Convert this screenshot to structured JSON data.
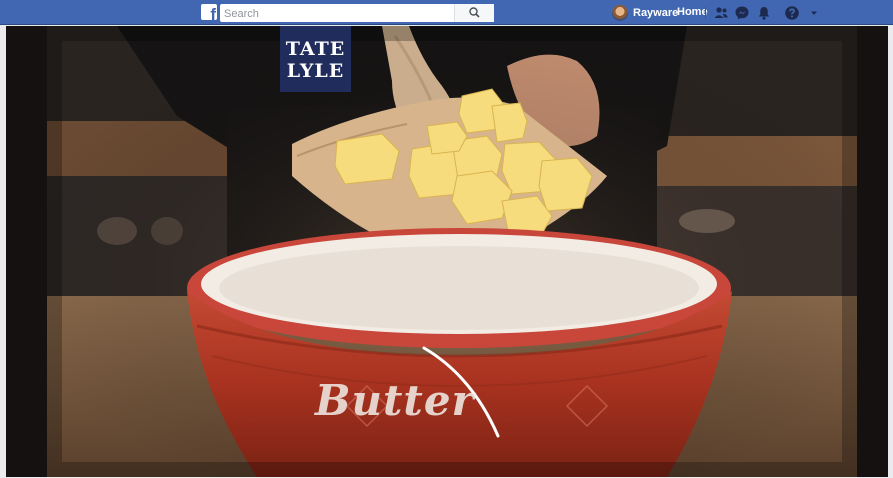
{
  "topbar": {
    "logo_letter": "f",
    "search": {
      "placeholder": "Search",
      "value": ""
    },
    "user_name": "Rayware",
    "home_label": "Home",
    "icons": [
      "friend-requests-icon",
      "messenger-icon",
      "notifications-icon",
      "help-icon",
      "account-menu-icon"
    ]
  },
  "video": {
    "brand_logo": {
      "line1": "TATE",
      "line2": "LYLE"
    },
    "caption": "Butter"
  },
  "colors": {
    "topbar": "#4267b2",
    "bowl": "#b83a2a",
    "logo_bg": "#1f2c5c"
  }
}
